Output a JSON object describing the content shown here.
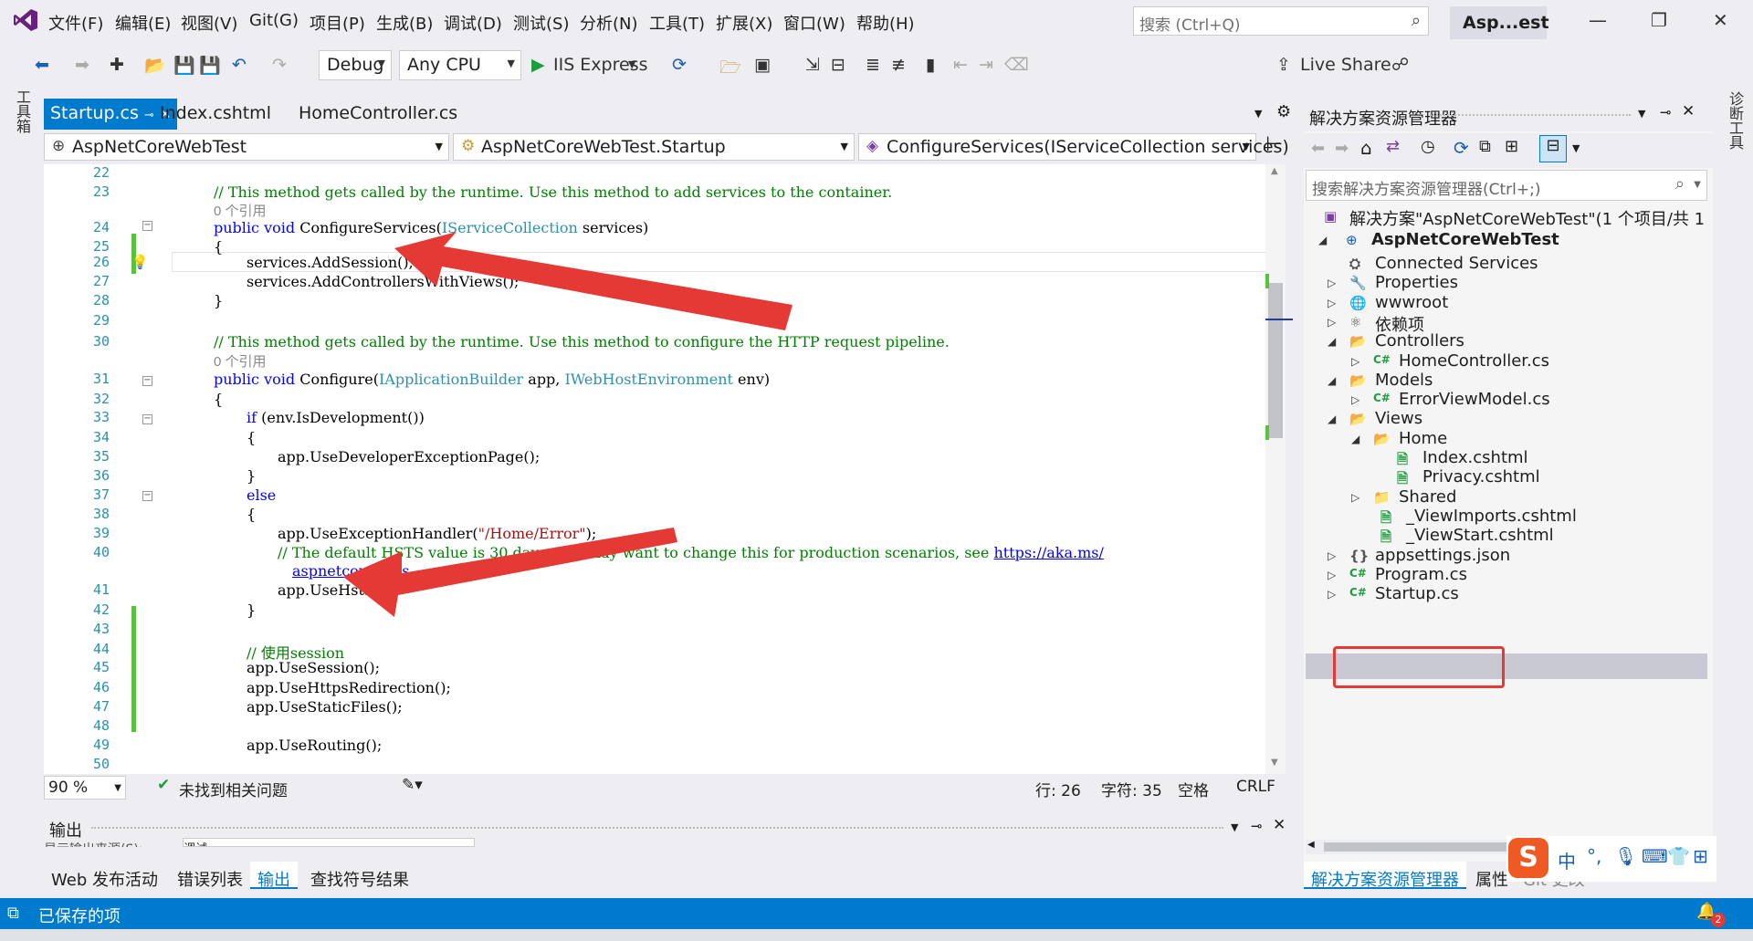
{
  "menubar": {
    "items": [
      "文件(F)",
      "编辑(E)",
      "视图(V)",
      "Git(G)",
      "项目(P)",
      "生成(B)",
      "调试(D)",
      "测试(S)",
      "分析(N)",
      "工具(T)",
      "扩展(X)",
      "窗口(W)",
      "帮助(H)"
    ],
    "search_placeholder": "搜索 (Ctrl+Q)",
    "app_name": "Asp...est"
  },
  "toolbar": {
    "config": "Debug",
    "platform": "Any CPU",
    "run_target": "IIS Express",
    "live_share": "Live Share"
  },
  "side": {
    "left_toolbox": "工具箱",
    "right_diag": "诊断工具"
  },
  "tabs": [
    {
      "label": "Startup.cs",
      "active": true
    },
    {
      "label": "Index.cshtml",
      "active": false
    },
    {
      "label": "HomeController.cs",
      "active": false
    }
  ],
  "nav": {
    "project": "AspNetCoreWebTest",
    "class": "AspNetCoreWebTest.Startup",
    "member": "ConfigureServices(IServiceCollection services)"
  },
  "editor": {
    "ref_count": "0 个引用",
    "comment1": "// This method gets called by the runtime. Use this method to add services to the container.",
    "comment2": "// This method gets called by the runtime. Use this method to configure the HTTP request pipeline.",
    "comment3": "// The default HSTS value is 30 days. You may want to change this for production scenarios, see ",
    "link1": "https://aka.ms/",
    "link2": "aspnetcore-hsts",
    "comment4": "// 使用session",
    "error_path": "\"/Home/Error\"",
    "line_numbers": [
      "22",
      "23",
      "",
      "24",
      "25",
      "26",
      "27",
      "28",
      "29",
      "30",
      "",
      "31",
      "32",
      "33",
      "34",
      "35",
      "36",
      "37",
      "38",
      "39",
      "40",
      "",
      "41",
      "42",
      "43",
      "44",
      "45",
      "46",
      "47",
      "48",
      "49",
      "50"
    ]
  },
  "editor_status": {
    "zoom": "90 %",
    "issues": "未找到相关问题",
    "line": "行: 26",
    "char": "字符: 35",
    "indent": "空格",
    "eol": "CRLF"
  },
  "output": {
    "title": "输出",
    "source_label": "显示输出来源(S):",
    "source_value": "调试"
  },
  "bottom_tabs": [
    "Web 发布活动",
    "错误列表",
    "输出",
    "查找符号结果"
  ],
  "statusbar": {
    "message": "已保存的项",
    "notifications": "2"
  },
  "solution": {
    "title": "解决方案资源管理器",
    "search_placeholder": "搜索解决方案资源管理器(Ctrl+;)",
    "solution_label": "解决方案\"AspNetCoreWebTest\"(1 个项目/共 1",
    "project": "AspNetCoreWebTest",
    "items": [
      "Connected Services",
      "Properties",
      "wwwroot",
      "依赖项",
      "Controllers",
      "HomeController.cs",
      "Models",
      "ErrorViewModel.cs",
      "Views",
      "Home",
      "Index.cshtml",
      "Privacy.cshtml",
      "Shared",
      "_ViewImports.cshtml",
      "_ViewStart.cshtml",
      "appsettings.json",
      "Program.cs",
      "Startup.cs"
    ],
    "bottom_tabs": [
      "解决方案资源管理器",
      "属性",
      "Git 更改"
    ]
  },
  "ime": {
    "lang": "中"
  },
  "colors": {
    "accent": "#007acc",
    "highlight": "#e53935",
    "change_bar": "#57c33d"
  }
}
